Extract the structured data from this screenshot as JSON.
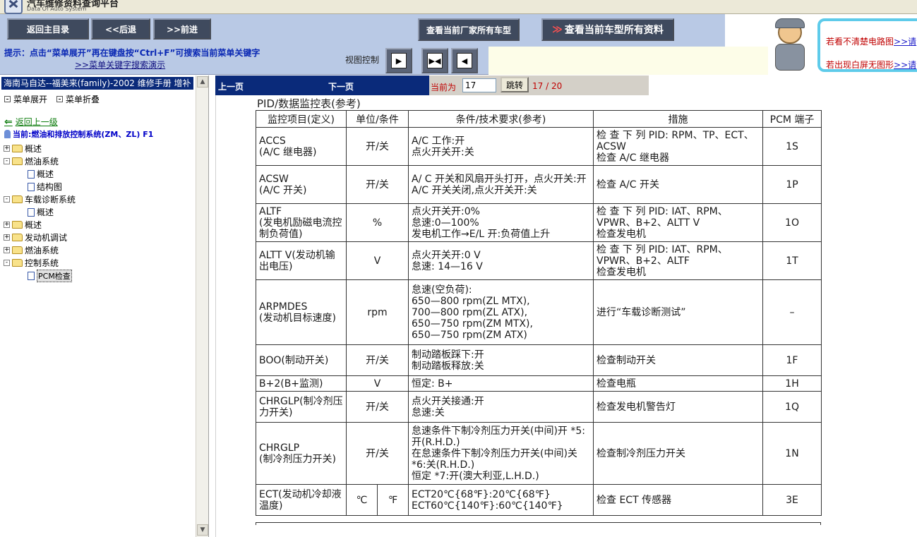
{
  "app": {
    "title": "汽车维修资料查询平台",
    "subtitle": "Data Of Auto System"
  },
  "toolbar": {
    "home": "返回主目录",
    "back": "<<后退",
    "forward": ">>前进",
    "all_models": "查看当前厂家所有车型",
    "all_docs": "查看当前车型所有资料"
  },
  "tip": {
    "text": "提示：点击“菜单展开”再在键盘按“Ctrl+F”可搜索当前菜单关键字",
    "link": ">>菜单关键字搜索演示",
    "view_label": "视图控制"
  },
  "help": {
    "line1": "若看不清楚电路图",
    "line1_link": ">>请",
    "line2": "若出现白屏无图形",
    "line2_link": ">>请"
  },
  "sidebar": {
    "title": "海南马自达--福美来(family)-2002 维修手册 增补",
    "expand": "菜单展开",
    "collapse": "菜单折叠",
    "back_up": "返回上一级",
    "current": "当前:燃油和排放控制系统(ZM、ZL) F1",
    "tree": [
      {
        "label": "概述",
        "type": "folder",
        "sign": "+"
      },
      {
        "label": "燃油系统",
        "type": "folder",
        "sign": "-"
      },
      {
        "label": "概述",
        "type": "doc"
      },
      {
        "label": "结构图",
        "type": "doc"
      },
      {
        "label": "车载诊断系统",
        "type": "folder",
        "sign": "-"
      },
      {
        "label": "概述",
        "type": "doc"
      },
      {
        "label": "概述",
        "type": "folder",
        "sign": "+"
      },
      {
        "label": "发动机调试",
        "type": "folder",
        "sign": "+"
      },
      {
        "label": "燃油系统",
        "type": "folder",
        "sign": "+"
      },
      {
        "label": "控制系统",
        "type": "folder",
        "sign": "-"
      },
      {
        "label": "PCM检查",
        "type": "doc",
        "selected": true
      }
    ]
  },
  "pagination": {
    "prev": "上一页",
    "next": "下一页",
    "current_label": "当前为",
    "current_page": "17",
    "jump": "跳转",
    "count": "17 / 20"
  },
  "document": {
    "title": "PID/数据监控表(参考)",
    "headers": [
      "监控项目(定义)",
      "单位/条件",
      "条件/技术要求(参考)",
      "措施",
      "PCM 端子"
    ],
    "rows": [
      {
        "item": "ACCS\n(A/C 继电器)",
        "unit": "开/关",
        "cond": "A/C 工作:开\n点火开关开:关",
        "action": "检 查 下 列 PID: RPM、TP、ECT、ACSW\n检查 A/C 继电器",
        "pin": "1S"
      },
      {
        "item": "ACSW\n(A/C 开关)",
        "unit": "开/关",
        "cond": "A/ C 开关和风扇开头打开，点火开关:开\nA/C 开关关闭,点火开关开:关",
        "action": "检查 A/C 开关",
        "pin": "1P"
      },
      {
        "item": "ALTF\n(发电机励磁电流控制负荷值)",
        "unit": "%",
        "cond": "点火开关开:0%\n怠速:0—100%\n发电机工作→E/L 开:负荷值上升",
        "action": "检 查 下 列 PID: IAT、RPM、VPWR、B+2、ALTT V\n检查发电机",
        "pin": "1O"
      },
      {
        "item": "ALTT V(发动机输出电压)",
        "unit": "V",
        "cond": "点火开关开:0 V\n怠速: 14—16 V",
        "action": "检 查 下 列 PID: IAT、RPM、VPWR、B+2、ALTF\n检查发电机",
        "pin": "1T"
      },
      {
        "item": "ARPMDES\n(发动机目标速度)",
        "unit": "rpm",
        "cond": "怠速(空负荷):\n650—800 rpm(ZL MTX),\n700—800 rpm(ZL ATX),\n650—750 rpm(ZM MTX),\n650—750 rpm(ZM ATX)",
        "action": "进行“车载诊断测试”",
        "pin": "–"
      },
      {
        "item": "BOO(制动开关)",
        "unit": "开/关",
        "cond": "制动踏板踩下:开\n制动踏板释放:关",
        "action": "检查制动开关",
        "pin": "1F"
      },
      {
        "item": "B+2(B+监测)",
        "unit": "V",
        "cond": "恒定: B+",
        "action": "检查电瓶",
        "pin": "1H"
      },
      {
        "item": "CHRGLP(制冷剂压力开关)",
        "unit": "开/关",
        "cond": "点火开关接通:开\n怠速:关",
        "action": "检查发电机警告灯",
        "pin": "1Q"
      },
      {
        "item": "CHRGLP\n(制冷剂压力开关)",
        "unit": "开/关",
        "cond": "怠速条件下制冷剂压力开关(中间)开 *5:开(R.H.D.)\n在怠速条件下制冷剂压力开关(中间)关 *6:关(R.H.D.)\n恒定 *7:开(澳大利亚,L.H.D.)",
        "action": "检查制冷剂压力开关",
        "pin": "1N"
      },
      {
        "item": "ECT(发动机冷却液温度)",
        "unit_c": "℃",
        "unit_f": "℉",
        "cond": "ECT20℃{68℉}:20℃{68℉}\nECT60℃{140℉}:60℃{140℉}",
        "action": "检查 ECT 传感器",
        "pin": "3E"
      }
    ]
  }
}
